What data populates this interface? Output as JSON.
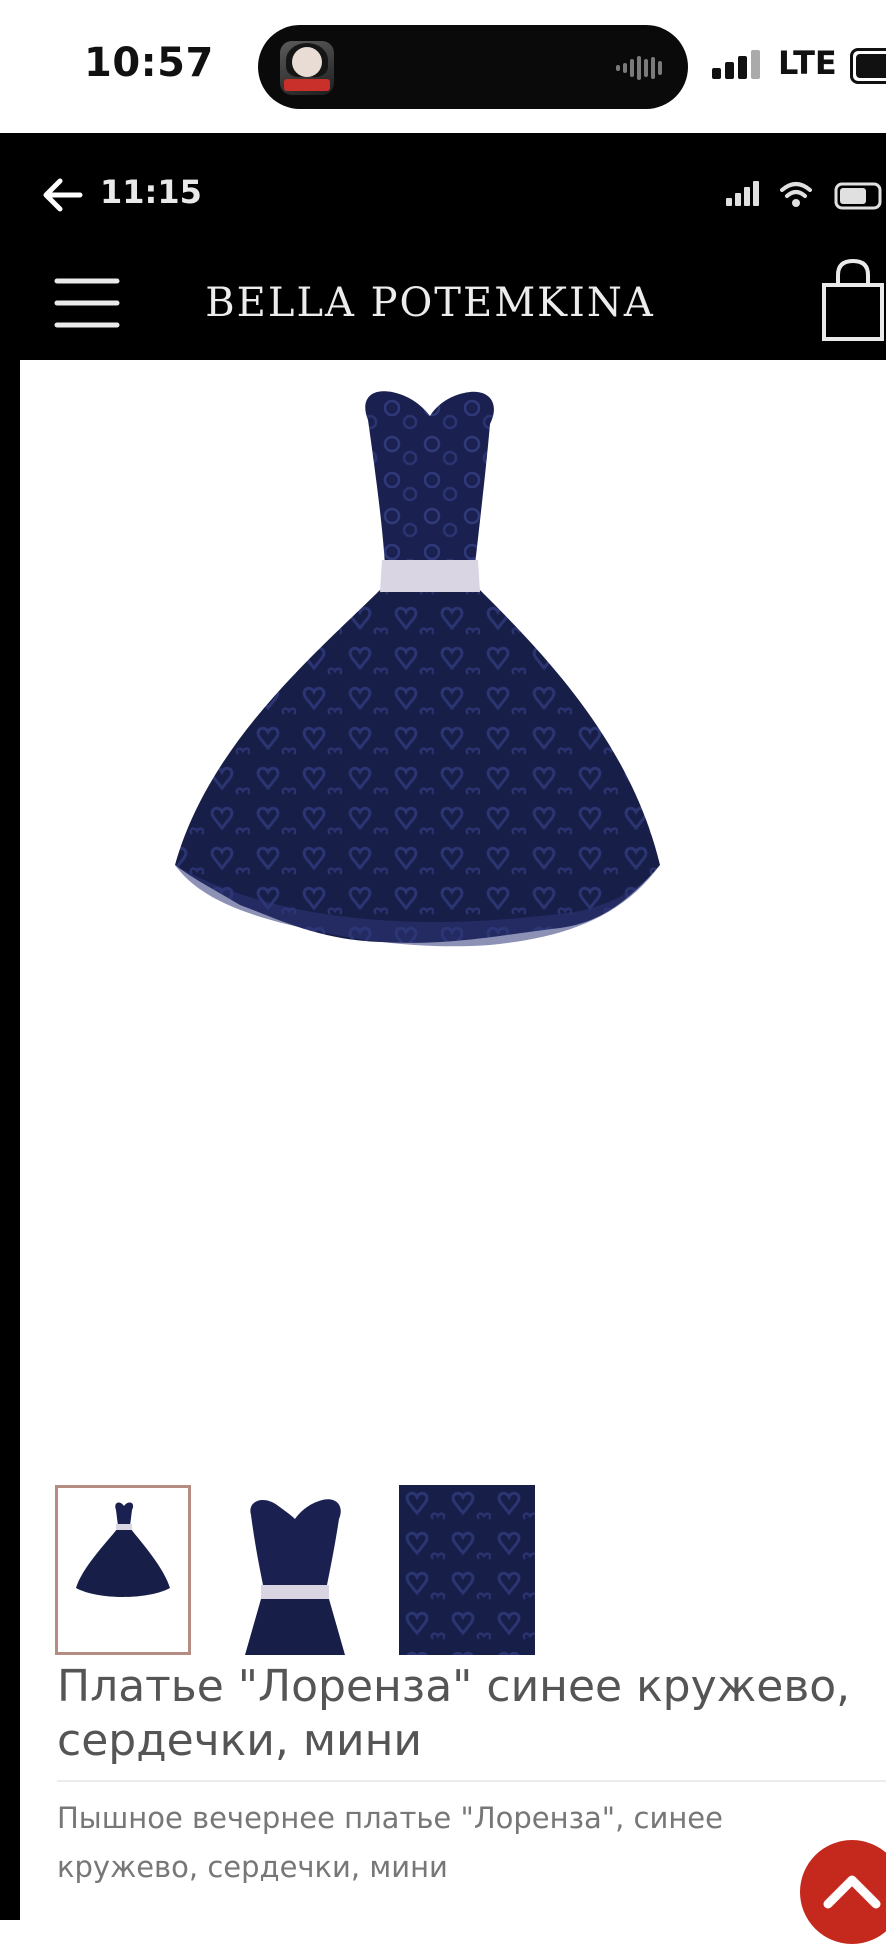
{
  "outer_status": {
    "time": "10:57",
    "network": "LTE"
  },
  "inner_status": {
    "time": "11:15"
  },
  "header": {
    "brand": "BELLA POTEMKINA"
  },
  "product": {
    "title": "Платье \"Лоренза\" синее кружево, сердечки, мини",
    "description": "Пышное вечернее платье \"Лоренза\", синее кружево, сердечки, мини",
    "thumbnails": [
      "full-dress",
      "bodice-closeup",
      "lace-closeup"
    ],
    "selected_thumbnail": 0
  },
  "colors": {
    "dress": "#161d45",
    "belt": "#d9d5e2",
    "accent": "#c5281d",
    "thumb_border": "#b48c82"
  }
}
